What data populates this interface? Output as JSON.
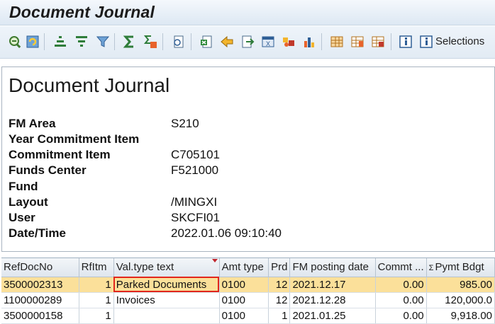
{
  "window": {
    "title": "Document Journal"
  },
  "toolbar": {
    "selections_label": "Selections",
    "icons": [
      "drilldown-icon",
      "refresh-icon",
      "sort-ascending-icon",
      "sort-descending-icon",
      "filter-icon",
      "sum-icon",
      "subtotal-icon",
      "details-icon",
      "export-spreadsheet-icon",
      "send-icon",
      "export-icon",
      "word-export-icon",
      "graphic-icon",
      "chart-icon",
      "layout-icon",
      "change-layout-icon",
      "save-layout-icon",
      "info-icon",
      "selections-info-icon"
    ]
  },
  "header": {
    "title": "Document Journal",
    "fields": [
      {
        "label": "FM Area",
        "value": "S210"
      },
      {
        "label": "Year Commitment Item",
        "value": ""
      },
      {
        "label": "Commitment Item",
        "value": "C705101"
      },
      {
        "label": "Funds Center",
        "value": "F521000"
      },
      {
        "label": "Fund",
        "value": ""
      },
      {
        "label": "Layout",
        "value": "/MINGXI"
      },
      {
        "label": "User",
        "value": "SKCFI01"
      },
      {
        "label": "Date/Time",
        "value": "2022.01.06 09:10:40"
      }
    ]
  },
  "table": {
    "columns": [
      "RefDocNo",
      "RfItm",
      "Val.type text",
      "Amt type",
      "Prd",
      "FM posting date",
      "Commt ...",
      "Pymt Bdgt"
    ],
    "rows": [
      [
        "3500002313",
        "1",
        "Parked Documents",
        "0100",
        "12",
        "2021.12.17",
        "0.00",
        "985.00"
      ],
      [
        "1100000289",
        "1",
        "Invoices",
        "0100",
        "12",
        "2021.12.28",
        "0.00",
        "120,000.0"
      ],
      [
        "3500000158",
        "1",
        "",
        "0100",
        "1",
        "2021.01.25",
        "0.00",
        "9,918.00"
      ]
    ]
  },
  "colors": {
    "selected_row": "#fbe09a",
    "highlight_border": "#e2261c"
  }
}
